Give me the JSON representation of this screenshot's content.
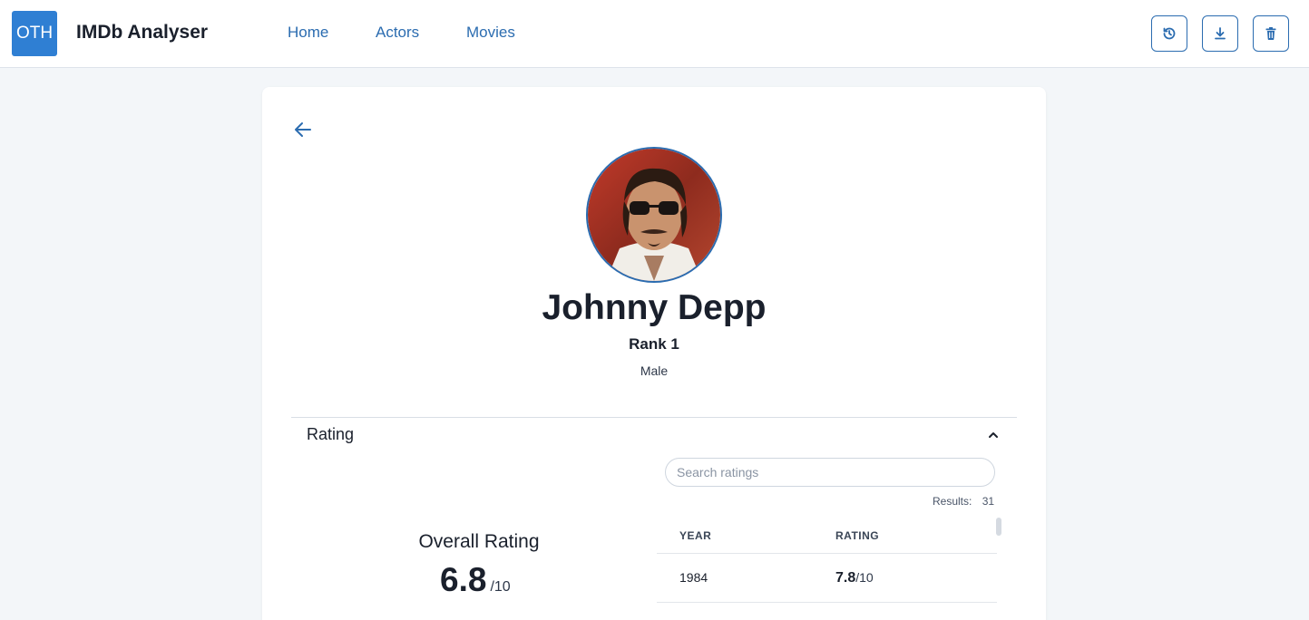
{
  "app": {
    "logo_text": "OTH",
    "title": "IMDb Analyser"
  },
  "nav": {
    "items": [
      {
        "label": "Home"
      },
      {
        "label": "Actors"
      },
      {
        "label": "Movies"
      }
    ]
  },
  "toolbar": {
    "buttons": [
      {
        "icon": "history-icon"
      },
      {
        "icon": "download-icon"
      },
      {
        "icon": "trash-icon"
      }
    ]
  },
  "colors": {
    "accent": "#2b6cb0",
    "logo_bg": "#2f7fd3",
    "page_bg": "#f3f6f9"
  },
  "actor": {
    "name": "Johnny Depp",
    "rank": "Rank 1",
    "gender": "Male"
  },
  "rating_section": {
    "title": "Rating",
    "search_placeholder": "Search ratings",
    "results_label": "Results:",
    "results_count": "31",
    "overall_label": "Overall Rating",
    "overall_value": "6.8",
    "overall_max": "/10",
    "table": {
      "headers": [
        "YEAR",
        "RATING"
      ],
      "rows": [
        {
          "year": "1984",
          "rating": "7.8",
          "max": "/10"
        }
      ]
    }
  }
}
